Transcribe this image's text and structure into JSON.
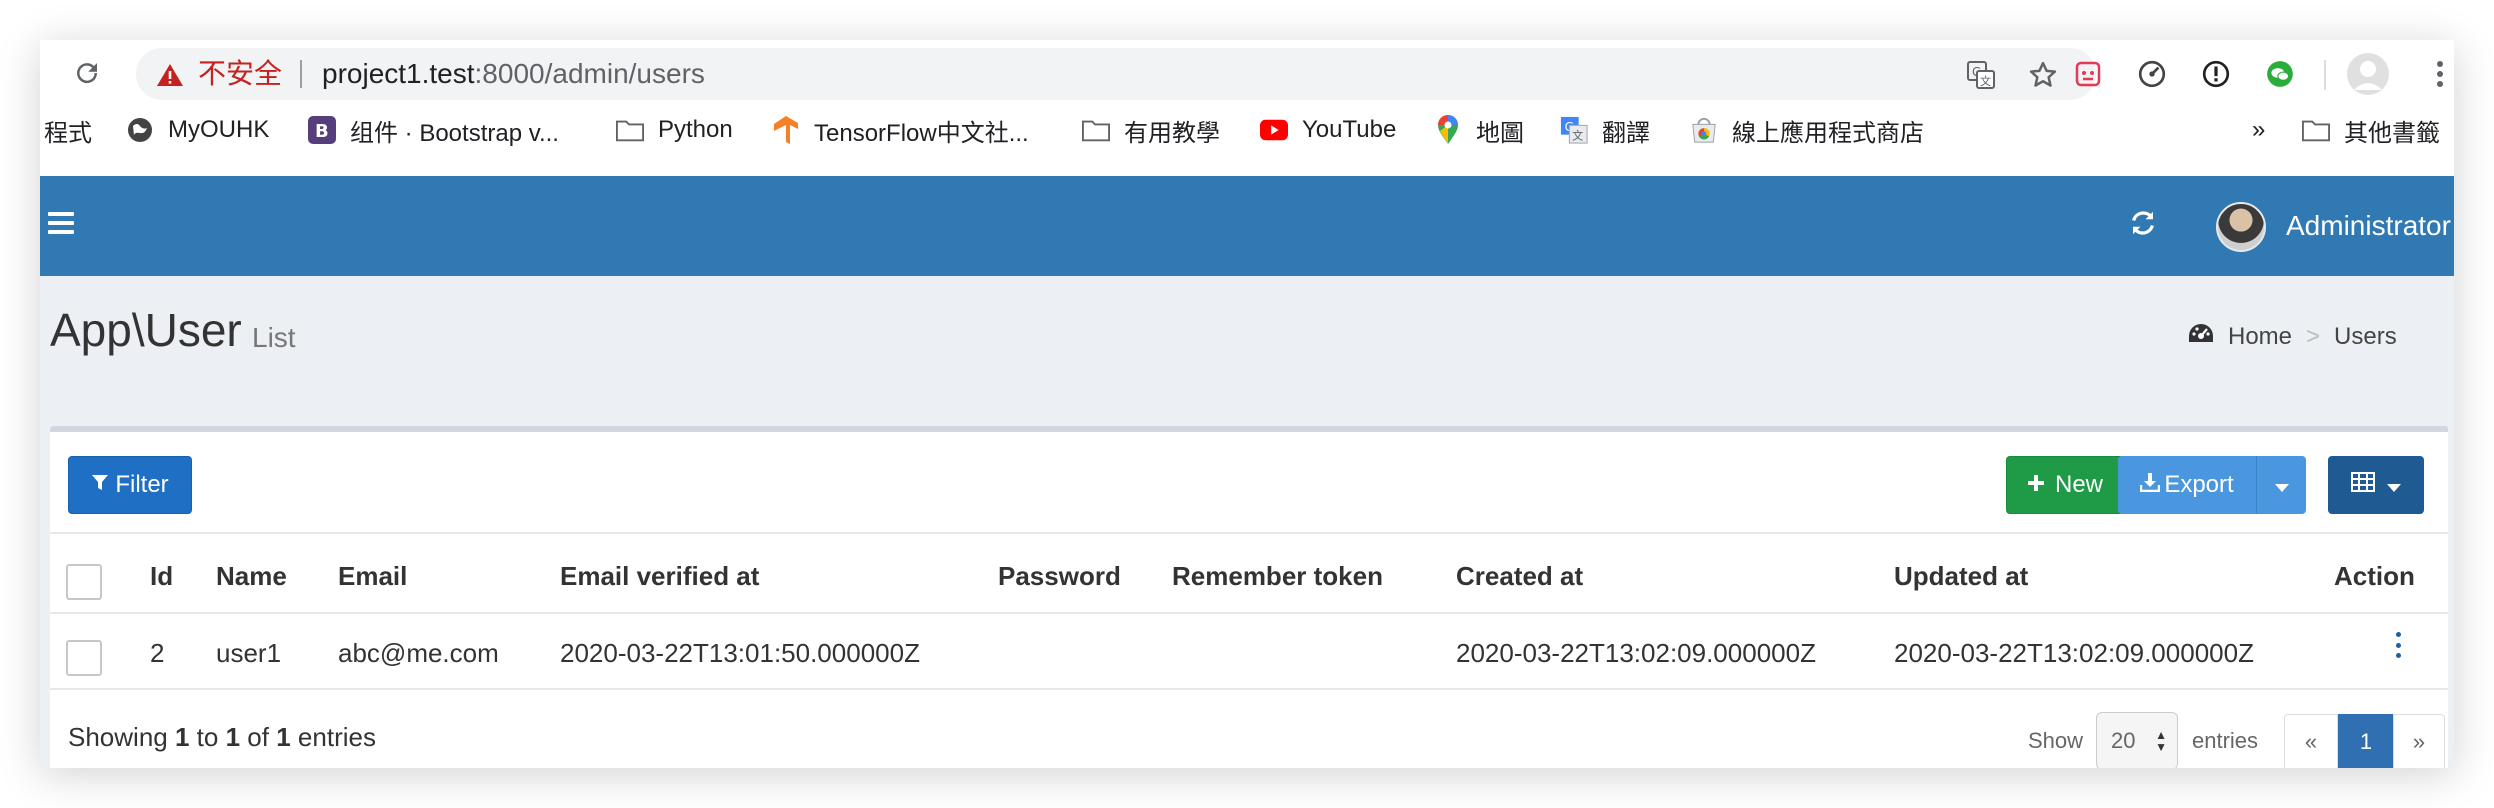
{
  "browser": {
    "insecure_label": "不安全",
    "url_host": "project1.test",
    "url_rest": ":8000/admin/users"
  },
  "bookmarks": [
    {
      "label": "程式",
      "icon": "none"
    },
    {
      "label": "MyOUHK",
      "icon": "globe-icon"
    },
    {
      "label": "组件 · Bootstrap v...",
      "icon": "bootstrap-icon"
    },
    {
      "label": "Python",
      "icon": "folder-icon"
    },
    {
      "label": "TensorFlow中文社...",
      "icon": "tensorflow-icon"
    },
    {
      "label": "有用教學",
      "icon": "folder-icon"
    },
    {
      "label": "YouTube",
      "icon": "youtube-icon"
    },
    {
      "label": "地圖",
      "icon": "maps-pin-icon"
    },
    {
      "label": "翻譯",
      "icon": "translate-icon"
    },
    {
      "label": "線上應用程式商店",
      "icon": "webstore-icon"
    },
    {
      "label": "»",
      "icon": "none"
    },
    {
      "label": "其他書籤",
      "icon": "folder-icon"
    }
  ],
  "header": {
    "user_name": "Administrator",
    "color": "#3079b2"
  },
  "page": {
    "title": "App\\User",
    "subtitle": "List",
    "breadcrumb": [
      "Home",
      ">",
      "Users"
    ]
  },
  "toolbar": {
    "filter_label": "Filter",
    "new_label": "New",
    "export_label": "Export"
  },
  "table": {
    "columns": [
      "Id",
      "Name",
      "Email",
      "Email verified at",
      "Password",
      "Remember token",
      "Created at",
      "Updated at",
      "Action"
    ],
    "rows": [
      {
        "id": "2",
        "name": "user1",
        "email": "abc@me.com",
        "email_verified_at": "2020-03-22T13:01:50.000000Z",
        "password": "",
        "remember_token": "",
        "created_at": "2020-03-22T13:02:09.000000Z",
        "updated_at": "2020-03-22T13:02:09.000000Z"
      }
    ]
  },
  "footer": {
    "showing_prefix": "Showing",
    "from": "1",
    "to_word": "to",
    "to": "1",
    "of_word": "of",
    "total": "1",
    "entries_word": "entries",
    "show_label": "Show",
    "per_page": "20",
    "entries_label": "entries",
    "prev": "«",
    "current_page": "1",
    "next": "»"
  }
}
